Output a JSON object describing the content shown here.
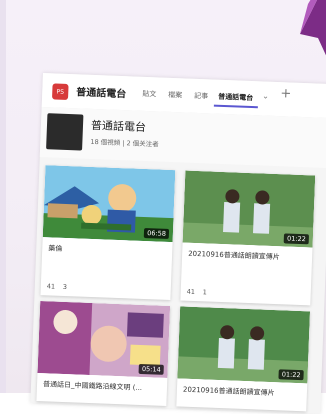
{
  "channel_bar": {
    "logo_text": "PS",
    "title": "普通話電台",
    "tabs": [
      {
        "label": "貼文"
      },
      {
        "label": "檔案"
      },
      {
        "label": "記事"
      },
      {
        "label": "普通話電台"
      }
    ],
    "active_tab": "普通話電台",
    "dropdown_glyph": "⌄",
    "add_glyph": "+"
  },
  "channel_header": {
    "title": "普通話電台",
    "meta": "18 個視頻 | 2 個关注者"
  },
  "videos": [
    {
      "title": "藥倫",
      "duration": "06:58",
      "likes": "41",
      "comments": "3"
    },
    {
      "title": "20210916普通話朗讀宣傳片",
      "duration": "01:22",
      "likes": "41",
      "comments": "1"
    },
    {
      "title": "普通話日_中國鐵路沿線文明 (...",
      "duration": "05:14"
    },
    {
      "title": "20210916普通話朗讀宣傳片",
      "duration": "01:22"
    }
  ],
  "colors": {
    "accent": "#5b57d1",
    "logo": "#d73a3a",
    "ribbon": "#7c2c86"
  }
}
